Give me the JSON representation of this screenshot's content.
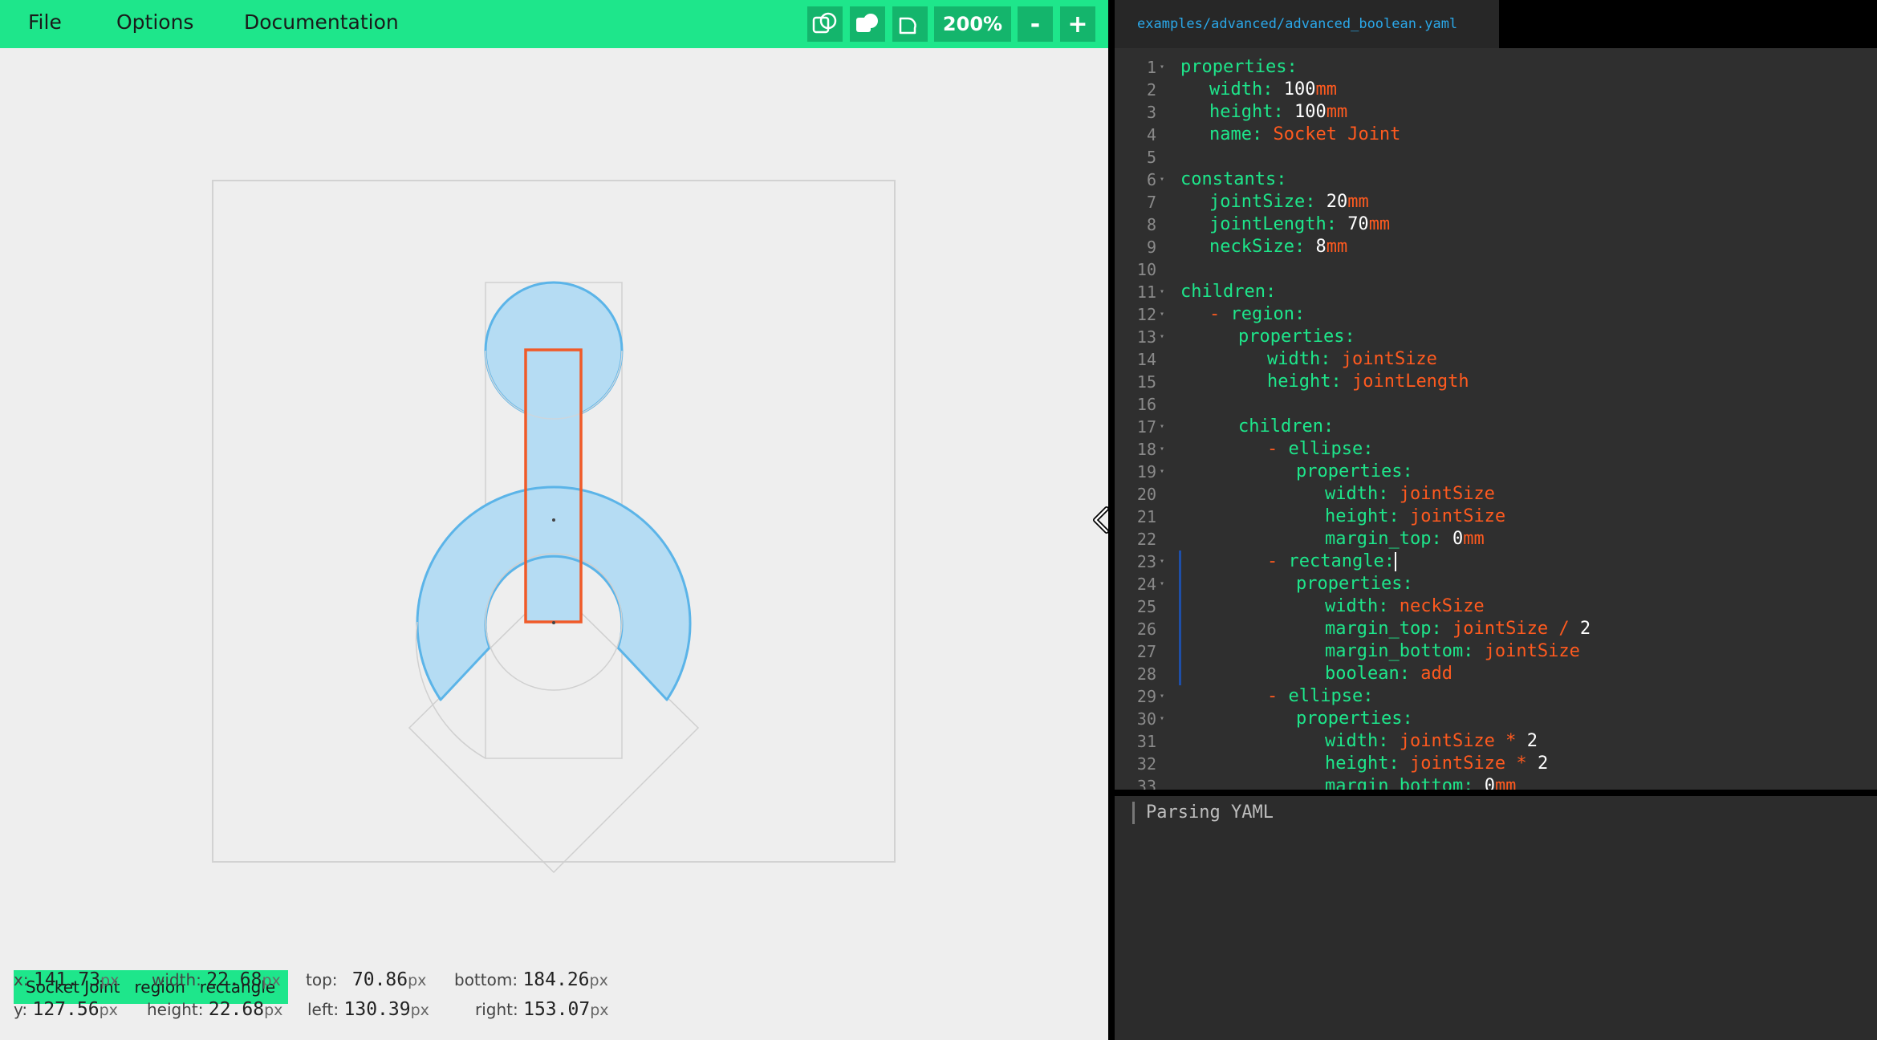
{
  "menu": {
    "file": "File",
    "options": "Options",
    "documentation": "Documentation"
  },
  "toolbar": {
    "icons": [
      "outline-overlap-icon",
      "filled-overlap-icon",
      "outline-shapes-icon"
    ],
    "zoom": "200%",
    "zoom_out": "-",
    "zoom_in": "+"
  },
  "canvas": {
    "shape_fill": "#b5dcf3",
    "shape_stroke": "#5bb4e8",
    "selection_color": "#f05a28"
  },
  "breadcrumb": [
    "Socket Joint",
    "region",
    "rectangle"
  ],
  "metrics": {
    "x": {
      "label": "x:",
      "value": "141.73",
      "unit": "px"
    },
    "y": {
      "label": "y:",
      "value": "127.56",
      "unit": "px"
    },
    "width": {
      "label": "width:",
      "value": "22.68",
      "unit": "px"
    },
    "height": {
      "label": "height:",
      "value": "22.68",
      "unit": "px"
    },
    "top": {
      "label": "top:",
      "value": "70.86",
      "unit": "px"
    },
    "left": {
      "label": "left:",
      "value": "130.39",
      "unit": "px"
    },
    "bottom": {
      "label": "bottom:",
      "value": "184.26",
      "unit": "px"
    },
    "right": {
      "label": "right:",
      "value": "153.07",
      "unit": "px"
    }
  },
  "editor": {
    "tab": "examples/advanced/advanced_boolean.yaml",
    "lines": [
      {
        "n": "1",
        "fold": true,
        "indent": 0,
        "parts": [
          [
            "key",
            "properties:"
          ]
        ]
      },
      {
        "n": "2",
        "indent": 1,
        "parts": [
          [
            "key",
            "width: "
          ],
          [
            "num",
            "100"
          ],
          [
            "unit",
            "mm"
          ]
        ]
      },
      {
        "n": "3",
        "indent": 1,
        "parts": [
          [
            "key",
            "height: "
          ],
          [
            "num",
            "100"
          ],
          [
            "unit",
            "mm"
          ]
        ]
      },
      {
        "n": "4",
        "indent": 1,
        "parts": [
          [
            "key",
            "name: "
          ],
          [
            "str",
            "Socket Joint"
          ]
        ]
      },
      {
        "n": "5",
        "indent": 0,
        "parts": []
      },
      {
        "n": "6",
        "fold": true,
        "indent": 0,
        "parts": [
          [
            "key",
            "constants:"
          ]
        ]
      },
      {
        "n": "7",
        "indent": 1,
        "parts": [
          [
            "key",
            "jointSize: "
          ],
          [
            "num",
            "20"
          ],
          [
            "unit",
            "mm"
          ]
        ]
      },
      {
        "n": "8",
        "indent": 1,
        "parts": [
          [
            "key",
            "jointLength: "
          ],
          [
            "num",
            "70"
          ],
          [
            "unit",
            "mm"
          ]
        ]
      },
      {
        "n": "9",
        "indent": 1,
        "parts": [
          [
            "key",
            "neckSize: "
          ],
          [
            "num",
            "8"
          ],
          [
            "unit",
            "mm"
          ]
        ]
      },
      {
        "n": "10",
        "indent": 0,
        "parts": []
      },
      {
        "n": "11",
        "fold": true,
        "indent": 0,
        "parts": [
          [
            "key",
            "children:"
          ]
        ]
      },
      {
        "n": "12",
        "fold": true,
        "indent": 1,
        "parts": [
          [
            "dash",
            "- "
          ],
          [
            "key",
            "region:"
          ]
        ]
      },
      {
        "n": "13",
        "fold": true,
        "indent": 2,
        "parts": [
          [
            "key",
            "properties:"
          ]
        ]
      },
      {
        "n": "14",
        "indent": 3,
        "parts": [
          [
            "key",
            "width: "
          ],
          [
            "str",
            "jointSize"
          ]
        ]
      },
      {
        "n": "15",
        "indent": 3,
        "parts": [
          [
            "key",
            "height: "
          ],
          [
            "str",
            "jointLength"
          ]
        ]
      },
      {
        "n": "16",
        "indent": 0,
        "parts": []
      },
      {
        "n": "17",
        "fold": true,
        "indent": 2,
        "parts": [
          [
            "key",
            "children:"
          ]
        ]
      },
      {
        "n": "18",
        "fold": true,
        "indent": 3,
        "parts": [
          [
            "dash",
            "- "
          ],
          [
            "key",
            "ellipse:"
          ]
        ]
      },
      {
        "n": "19",
        "fold": true,
        "indent": 4,
        "parts": [
          [
            "key",
            "properties:"
          ]
        ]
      },
      {
        "n": "20",
        "indent": 5,
        "parts": [
          [
            "key",
            "width: "
          ],
          [
            "str",
            "jointSize"
          ]
        ]
      },
      {
        "n": "21",
        "indent": 5,
        "parts": [
          [
            "key",
            "height: "
          ],
          [
            "str",
            "jointSize"
          ]
        ]
      },
      {
        "n": "22",
        "indent": 5,
        "parts": [
          [
            "key",
            "margin_top: "
          ],
          [
            "num",
            "0"
          ],
          [
            "unit",
            "mm"
          ]
        ]
      },
      {
        "n": "23",
        "fold": true,
        "indent": 3,
        "cursor": true,
        "parts": [
          [
            "dash",
            "- "
          ],
          [
            "key",
            "rectangle:"
          ]
        ]
      },
      {
        "n": "24",
        "fold": true,
        "indent": 4,
        "parts": [
          [
            "key",
            "properties:"
          ]
        ]
      },
      {
        "n": "25",
        "indent": 5,
        "parts": [
          [
            "key",
            "width: "
          ],
          [
            "str",
            "neckSize"
          ]
        ]
      },
      {
        "n": "26",
        "indent": 5,
        "parts": [
          [
            "key",
            "margin_top: "
          ],
          [
            "str",
            "jointSize"
          ],
          [
            "op",
            " / "
          ],
          [
            "num",
            "2"
          ]
        ]
      },
      {
        "n": "27",
        "indent": 5,
        "parts": [
          [
            "key",
            "margin_bottom: "
          ],
          [
            "str",
            "jointSize"
          ]
        ]
      },
      {
        "n": "28",
        "indent": 5,
        "parts": [
          [
            "key",
            "boolean: "
          ],
          [
            "str",
            "add"
          ]
        ]
      },
      {
        "n": "29",
        "fold": true,
        "indent": 3,
        "parts": [
          [
            "dash",
            "- "
          ],
          [
            "key",
            "ellipse:"
          ]
        ]
      },
      {
        "n": "30",
        "fold": true,
        "indent": 4,
        "parts": [
          [
            "key",
            "properties:"
          ]
        ]
      },
      {
        "n": "31",
        "indent": 5,
        "parts": [
          [
            "key",
            "width: "
          ],
          [
            "str",
            "jointSize"
          ],
          [
            "op",
            " * "
          ],
          [
            "num",
            "2"
          ]
        ]
      },
      {
        "n": "32",
        "indent": 5,
        "parts": [
          [
            "key",
            "height: "
          ],
          [
            "str",
            "jointSize"
          ],
          [
            "op",
            " * "
          ],
          [
            "num",
            "2"
          ]
        ]
      },
      {
        "n": "33",
        "indent": 5,
        "parts": [
          [
            "key",
            "margin_bottom: "
          ],
          [
            "num",
            "0"
          ],
          [
            "unit",
            "mm"
          ]
        ]
      }
    ]
  },
  "console": {
    "message": "Parsing YAML"
  }
}
